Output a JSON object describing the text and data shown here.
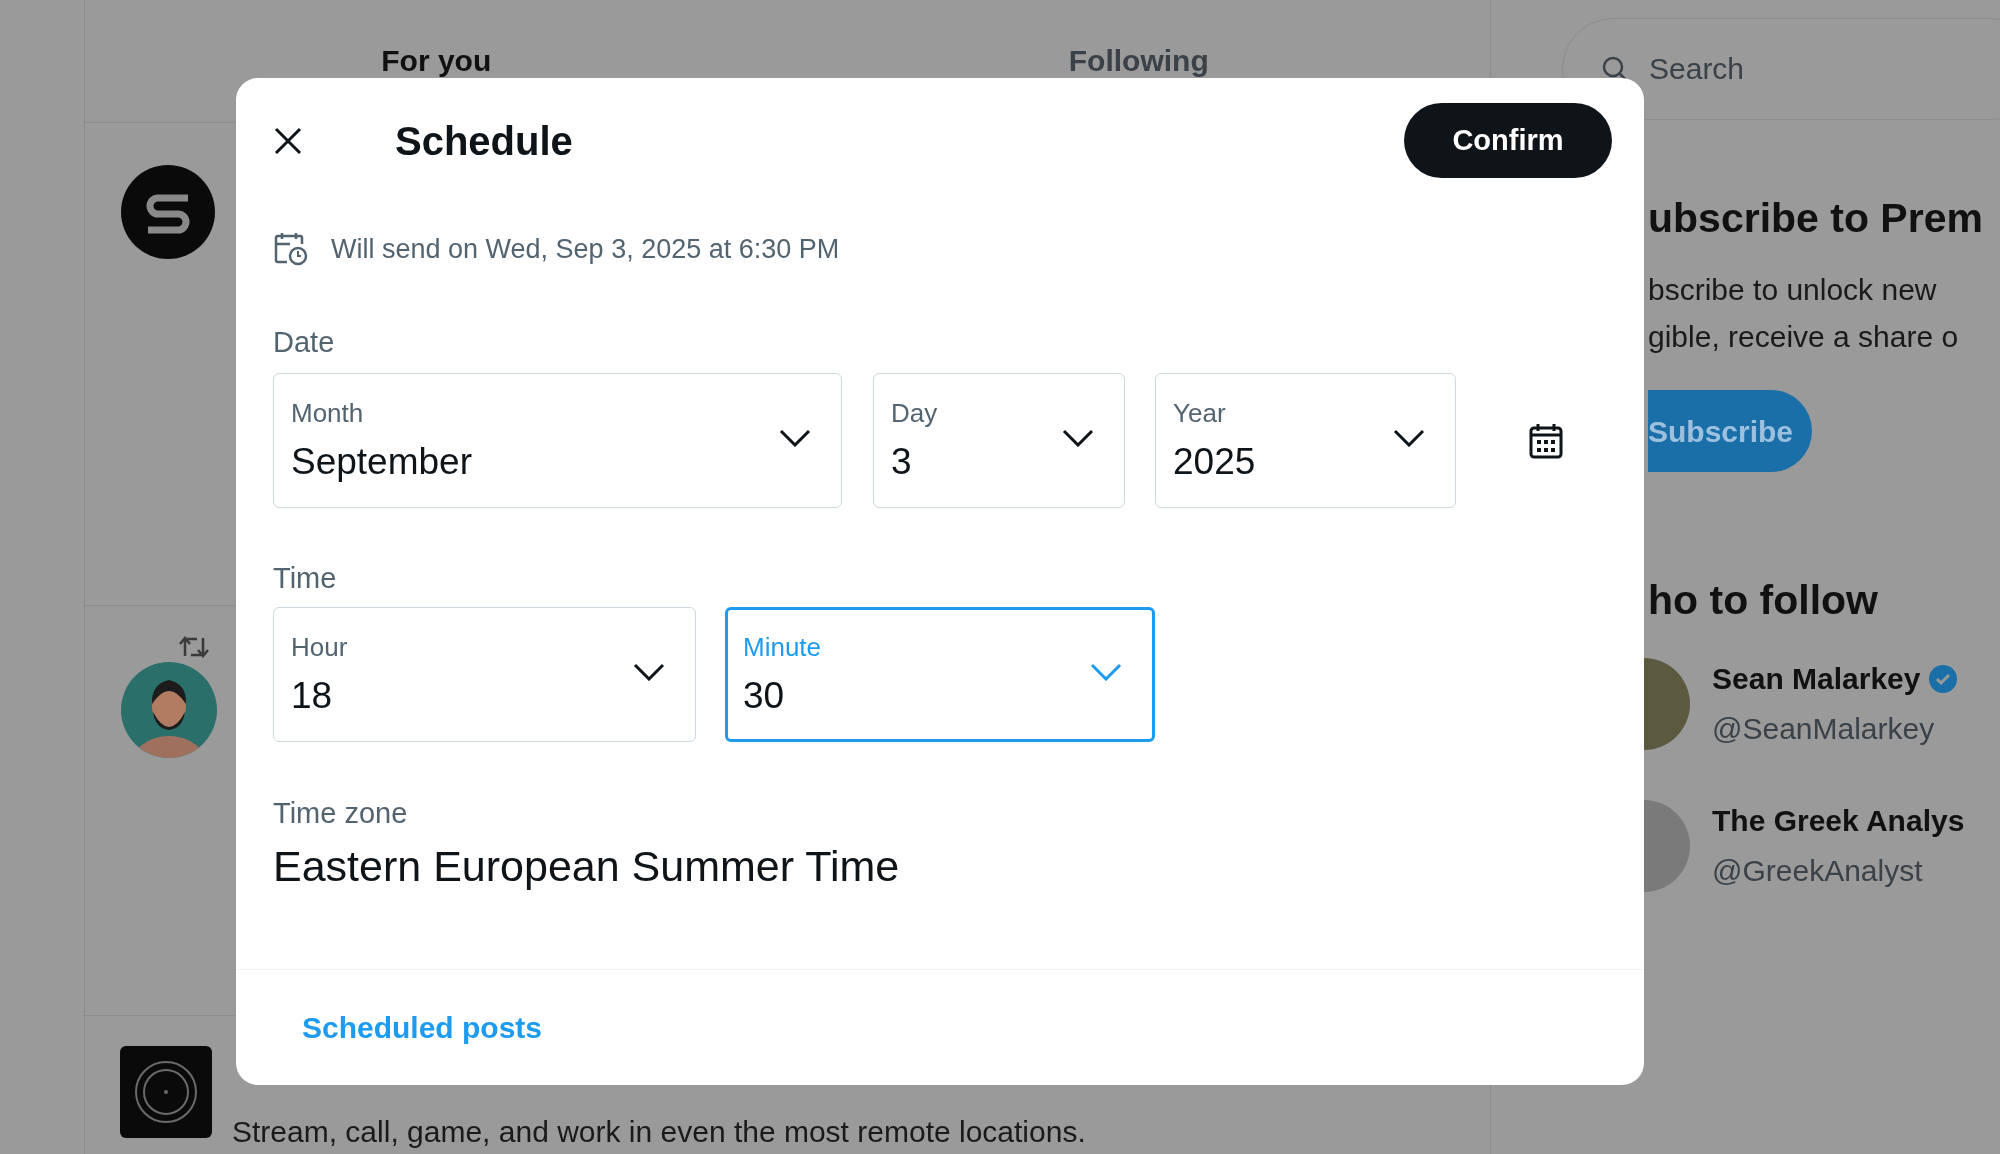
{
  "background": {
    "tabs": [
      {
        "label": "For you",
        "selected": true
      },
      {
        "label": "Following",
        "selected": false
      }
    ],
    "search": {
      "placeholder": "Search"
    },
    "premium": {
      "title": "ubscribe to Prem",
      "lines": [
        "bscribe to unlock new",
        "gible, receive a share o"
      ],
      "button": "Subscribe"
    },
    "who_to_follow": {
      "title": "ho to follow",
      "accounts": [
        {
          "name": "Sean Malarkey",
          "handle": "@SeanMalarkey",
          "verified": true
        },
        {
          "name": "The Greek Analys",
          "handle": "@GreekAnalyst",
          "verified": false
        }
      ]
    },
    "post": {
      "text": "Stream, call, game, and work in even the most remote locations."
    }
  },
  "dialog": {
    "title": "Schedule",
    "confirm": "Confirm",
    "summary": "Will send on Wed, Sep 3, 2025 at 6:30 PM",
    "date": {
      "label": "Date",
      "fields": [
        {
          "label": "Month",
          "value": "September",
          "focused": false
        },
        {
          "label": "Day",
          "value": "3",
          "focused": false
        },
        {
          "label": "Year",
          "value": "2025",
          "focused": false
        }
      ]
    },
    "time": {
      "label": "Time",
      "fields": [
        {
          "label": "Hour",
          "value": "18",
          "focused": false
        },
        {
          "label": "Minute",
          "value": "30",
          "focused": true
        }
      ]
    },
    "timezone": {
      "label": "Time zone",
      "value": "Eastern European Summer Time"
    },
    "footer_link": "Scheduled posts"
  }
}
